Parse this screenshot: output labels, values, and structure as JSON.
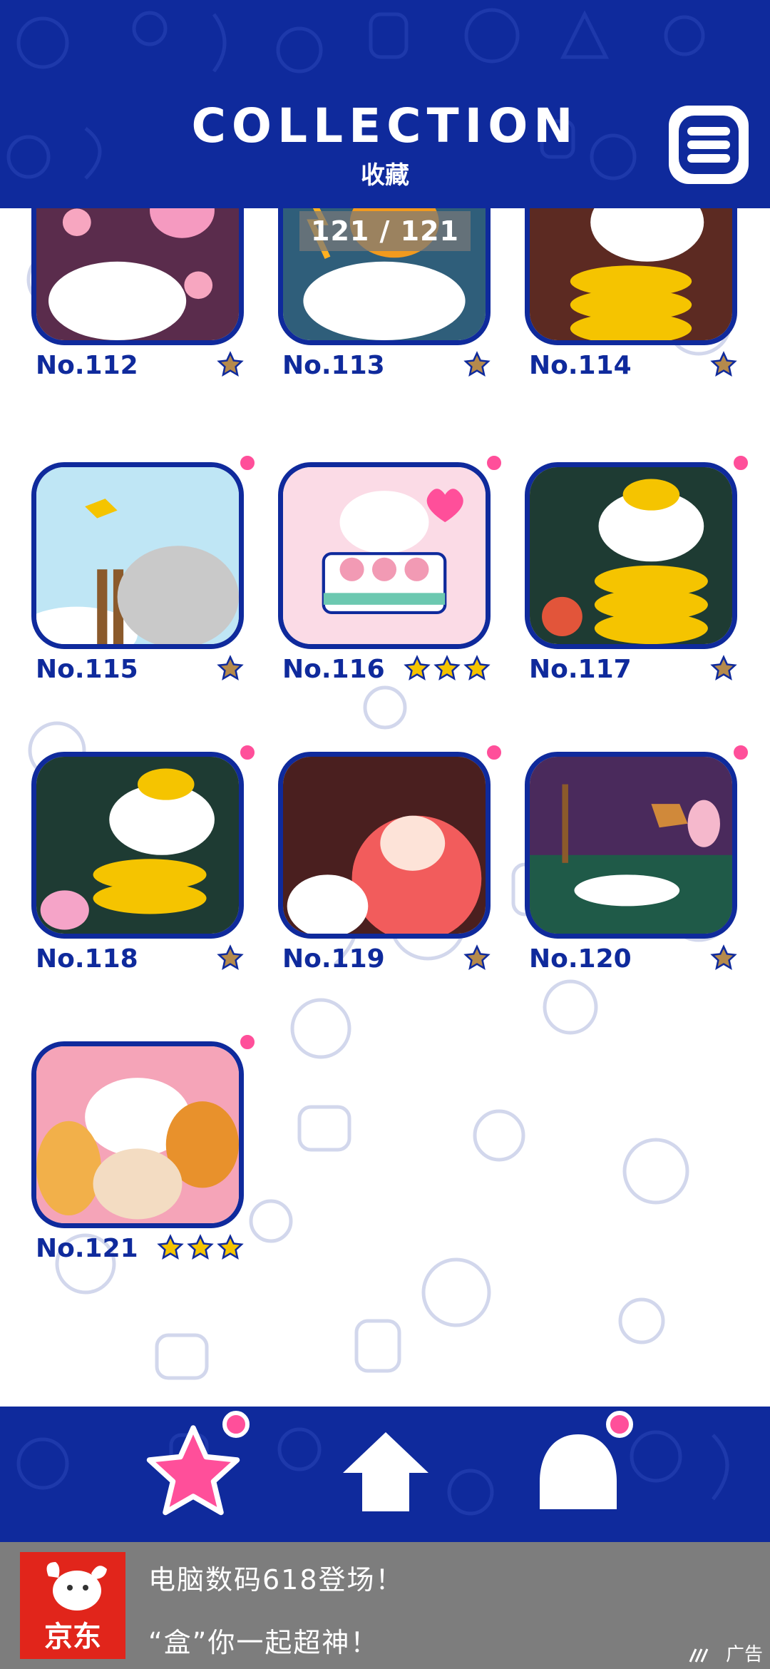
{
  "header": {
    "title": "COLLECTION",
    "subtitle": "收藏",
    "menu_icon": "menu-list-icon"
  },
  "counter": {
    "text": "121 / 121",
    "current": 121,
    "total": 121
  },
  "colors": {
    "brand_blue": "#0f2a9c",
    "accent_pink": "#ff4f9a",
    "star_gold": "#f5c400",
    "star_bronze": "#b58a4c"
  },
  "collection": [
    {
      "label": "No.112",
      "stars": 1,
      "star_style": "bronze",
      "new": false
    },
    {
      "label": "No.113",
      "stars": 1,
      "star_style": "bronze",
      "new": false
    },
    {
      "label": "No.114",
      "stars": 1,
      "star_style": "bronze",
      "new": false
    },
    {
      "label": "No.115",
      "stars": 1,
      "star_style": "bronze",
      "new": true
    },
    {
      "label": "No.116",
      "stars": 3,
      "star_style": "gold",
      "new": true
    },
    {
      "label": "No.117",
      "stars": 1,
      "star_style": "bronze",
      "new": true
    },
    {
      "label": "No.118",
      "stars": 1,
      "star_style": "bronze",
      "new": true
    },
    {
      "label": "No.119",
      "stars": 1,
      "star_style": "bronze",
      "new": true
    },
    {
      "label": "No.120",
      "stars": 1,
      "star_style": "bronze",
      "new": true
    },
    {
      "label": "No.121",
      "stars": 3,
      "star_style": "gold",
      "new": true
    }
  ],
  "nav": {
    "items": [
      {
        "icon": "star-icon",
        "active": true,
        "badge": true
      },
      {
        "icon": "home-icon",
        "active": false,
        "badge": false
      },
      {
        "icon": "character-icon",
        "active": false,
        "badge": true
      }
    ]
  },
  "ad": {
    "brand": "京东",
    "line1": "电脑数码618登场！",
    "line2": "“盒”你一起超神！",
    "tag": "广告"
  }
}
